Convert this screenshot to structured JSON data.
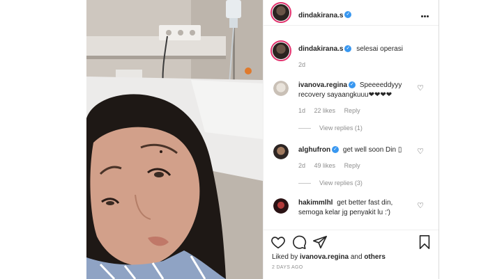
{
  "post": {
    "author": "dindakirana.s",
    "caption": "selesai operasi",
    "caption_age": "2d",
    "liked_by_prefix": "Liked by",
    "liked_by_user": "ivanova.regina",
    "liked_by_and": "and",
    "liked_by_others": "others",
    "timestamp": "2 DAYS AGO"
  },
  "comments": [
    {
      "user": "ivanova.regina",
      "verified": true,
      "line1": "Speeeeddyyy",
      "line2": "recovery sayaangkuuu❤❤❤❤",
      "age": "1d",
      "likes": "22 likes",
      "reply": "Reply",
      "view_replies": "View replies (1)"
    },
    {
      "user": "alghufron",
      "verified": true,
      "line1": "get well soon Din ▯",
      "age": "2d",
      "likes": "49 likes",
      "reply": "Reply",
      "view_replies": "View replies (3)"
    },
    {
      "user": "hakimmlhl",
      "verified": false,
      "line1": "get better fast din,",
      "line2": "semoga kelar jg penyakit lu :')"
    }
  ],
  "icons": {
    "more": "more-options-icon",
    "heart": "heart-icon",
    "comment": "comment-icon",
    "share": "share-icon",
    "save": "bookmark-icon",
    "verified": "verified-badge-icon"
  },
  "colors": {
    "verified": "#3897f0",
    "story_ring": "#e1306c",
    "muted": "#8e8e8e",
    "text": "#262626"
  }
}
